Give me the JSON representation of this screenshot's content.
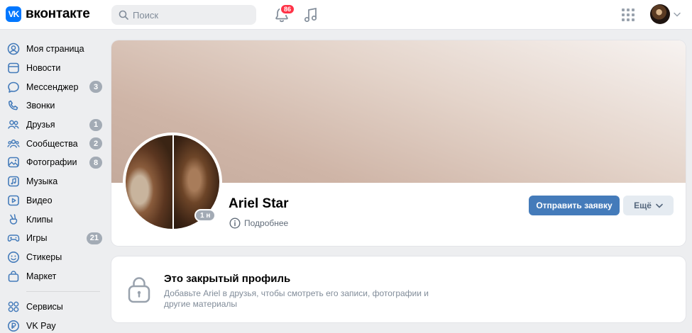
{
  "header": {
    "logo_mark": "VK",
    "logo_text": "вконтакте",
    "search_placeholder": "Поиск",
    "notifications_count": "86",
    "icons": [
      "search-icon",
      "bell-icon",
      "music-icon",
      "apps-grid-icon",
      "chevron-down-icon"
    ]
  },
  "sidebar": {
    "items": [
      {
        "label": "Моя страница",
        "icon": "user-circle-icon",
        "count": ""
      },
      {
        "label": "Новости",
        "icon": "news-icon",
        "count": ""
      },
      {
        "label": "Мессенджер",
        "icon": "message-icon",
        "count": "3"
      },
      {
        "label": "Звонки",
        "icon": "phone-icon",
        "count": ""
      },
      {
        "label": "Друзья",
        "icon": "friends-icon",
        "count": "1"
      },
      {
        "label": "Сообщества",
        "icon": "communities-icon",
        "count": "2"
      },
      {
        "label": "Фотографии",
        "icon": "photo-icon",
        "count": "8"
      },
      {
        "label": "Музыка",
        "icon": "music-icon",
        "count": ""
      },
      {
        "label": "Видео",
        "icon": "video-icon",
        "count": ""
      },
      {
        "label": "Клипы",
        "icon": "clips-icon",
        "count": ""
      },
      {
        "label": "Игры",
        "icon": "gamepad-icon",
        "count": "21"
      },
      {
        "label": "Стикеры",
        "icon": "smile-icon",
        "count": ""
      },
      {
        "label": "Маркет",
        "icon": "bag-icon",
        "count": ""
      }
    ],
    "extra_items": [
      {
        "label": "Сервисы",
        "icon": "services-icon"
      },
      {
        "label": "VK Pay",
        "icon": "ruble-icon"
      }
    ]
  },
  "profile": {
    "name": "Ariel Star",
    "online_status": "1 н",
    "details_label": "Подробнее",
    "add_friend_button": "Отправить заявку",
    "more_button": "Ещё"
  },
  "private_profile": {
    "title": "Это закрытый профиль",
    "description": "Добавьте Ariel в друзья, чтобы смотреть его записи, фотографии и другие материалы"
  },
  "colors": {
    "brand": "#0077ff",
    "primary_button": "#447bba",
    "badge_red": "#ff3347",
    "counter_gray": "#a3abb5"
  }
}
